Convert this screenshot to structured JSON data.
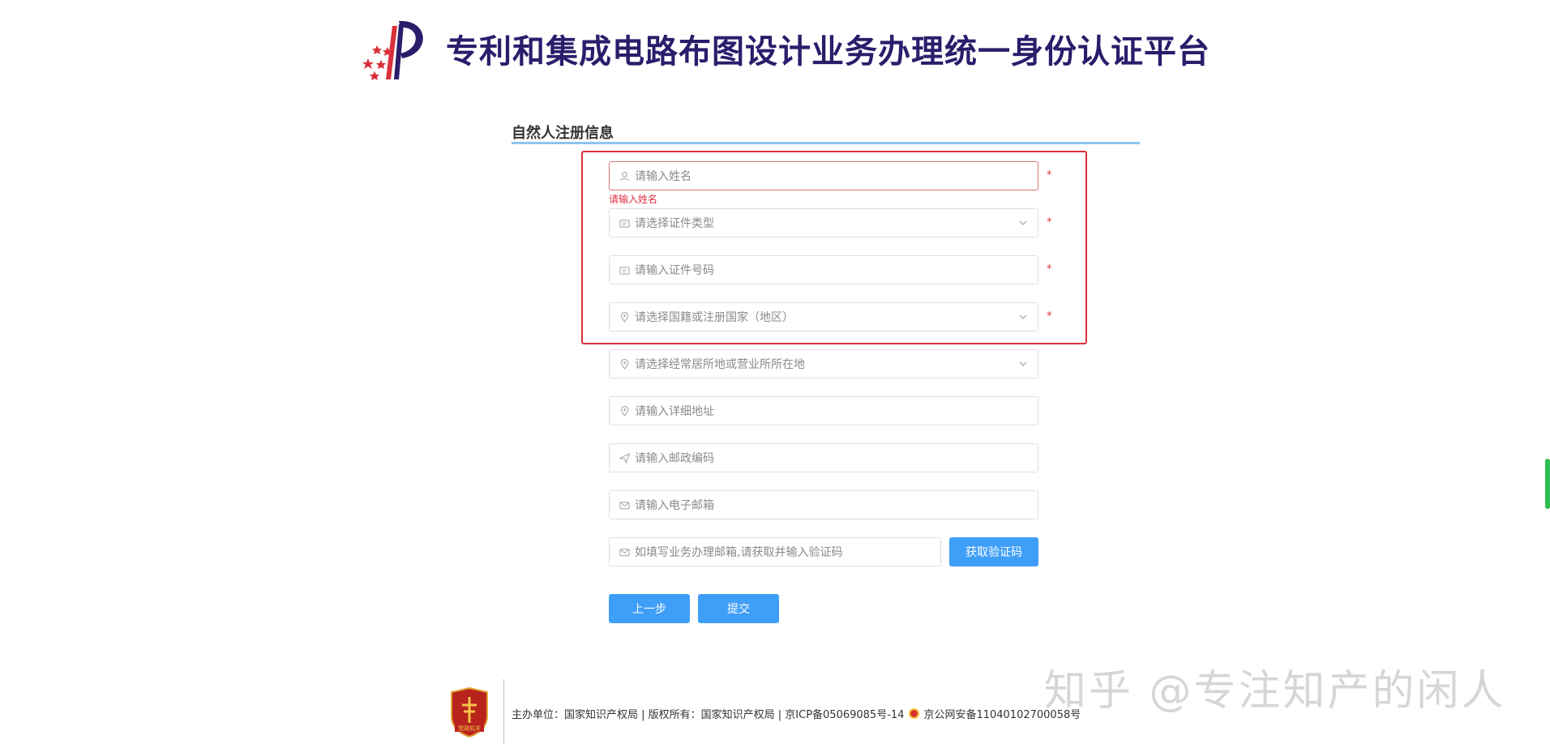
{
  "header": {
    "title": "专利和集成电路布图设计业务办理统一身份认证平台"
  },
  "section": {
    "title": "自然人注册信息"
  },
  "form": {
    "name": {
      "placeholder": "请输入姓名",
      "error": "请输入姓名",
      "required_mark": "*"
    },
    "id_type": {
      "placeholder": "请选择证件类型",
      "required_mark": "*"
    },
    "id_number": {
      "placeholder": "请输入证件号码",
      "required_mark": "*"
    },
    "nationality": {
      "placeholder": "请选择国籍或注册国家（地区）",
      "required_mark": "*"
    },
    "residence": {
      "placeholder": "请选择经常居所地或营业所所在地"
    },
    "address": {
      "placeholder": "请输入详细地址"
    },
    "postcode": {
      "placeholder": "请输入邮政编码"
    },
    "email": {
      "placeholder": "请输入电子邮箱"
    },
    "verify_code": {
      "placeholder": "如填写业务办理邮箱,请获取并输入验证码"
    },
    "get_code_label": "获取验证码",
    "prev_label": "上一步",
    "submit_label": "提交"
  },
  "footer": {
    "emblem_text": "党政机关",
    "info": "主办单位：国家知识产权局 | 版权所有：国家知识产权局 | 京ICP备05069085号-14",
    "police": "京公网安备11040102700058号"
  },
  "watermark": "知乎 @专注知产的闲人",
  "colors": {
    "title": "#2b1d6b",
    "accent": "#3f9ff8",
    "error": "#e0313b",
    "highlight": "#d9303a",
    "section_line": "#8cc6ee"
  }
}
